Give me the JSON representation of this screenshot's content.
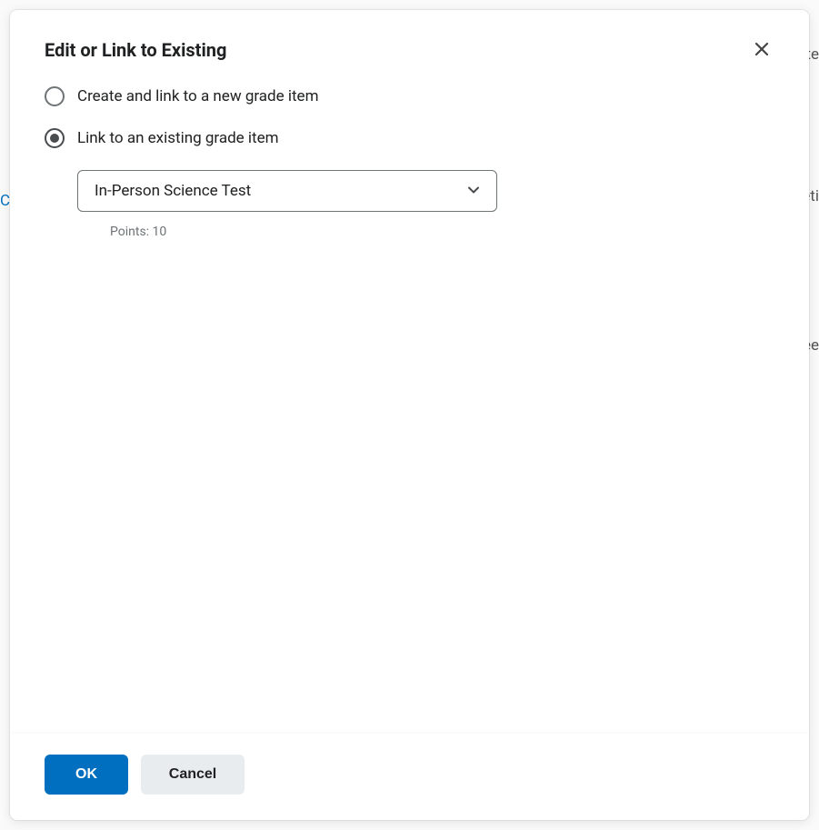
{
  "modal": {
    "title": "Edit or Link to Existing",
    "options": {
      "create": {
        "label": "Create and link to a new grade item",
        "selected": false
      },
      "link": {
        "label": "Link to an existing grade item",
        "selected": true
      }
    },
    "select": {
      "value": "In-Person Science Test"
    },
    "points_label": "Points: 10",
    "footer": {
      "ok": "OK",
      "cancel": "Cancel"
    }
  },
  "background": {
    "t1": "ite",
    "t2": "eti",
    "t3": "Fee",
    "t4": "Ch"
  }
}
